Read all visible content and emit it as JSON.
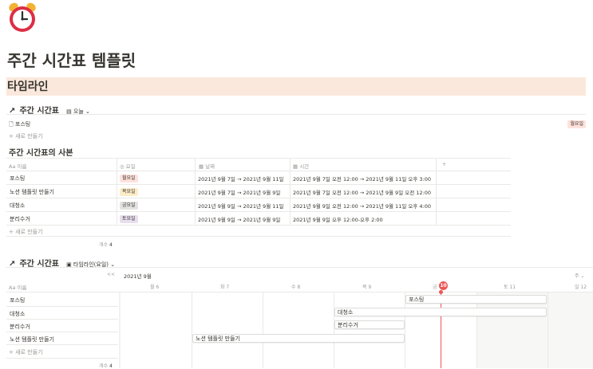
{
  "page": {
    "icon": "alarm-clock-icon",
    "title": "주간 시간표 템플릿",
    "heading": "타임라인"
  },
  "db1": {
    "title": "주간 시간표",
    "view_label": "오늘",
    "item": {
      "name": "포스팅",
      "tag": "월요일"
    },
    "new_label": "+ 새로 만들기"
  },
  "db2": {
    "title": "주간 시간표의 사본",
    "columns": [
      "이름",
      "요일",
      "날짜",
      "시간"
    ],
    "add_column": "+",
    "rows": [
      {
        "name": "포스팅",
        "day": "월요일",
        "date": "2021년 9월 7일 → 2021년 9월 11일",
        "time": "2021년 9월 7일 오전 12:00 → 2021년 9월 11일 오후 3:00"
      },
      {
        "name": "노션 템플릿 만들기",
        "day": "목요일",
        "date": "2021년 9월 7일 → 2021년 9월 9일",
        "time": "2021년 9월 7일 오전 12:00 → 2021년 9월 9일 오전 12:00"
      },
      {
        "name": "대청소",
        "day": "금요일",
        "date": "2021년 9월 9일 → 2021년 9월 11일",
        "time": "2021년 9월 9일 오전 12:00 → 2021년 9월 11일 오후 4:00"
      },
      {
        "name": "분리수거",
        "day": "토요일",
        "date": "2021년 9월 9일 → 2021년 9월 9일",
        "time": "2021년 9월 9일 오후 12:00-오후 2:00"
      }
    ],
    "new_label": "+ 새로 만들기",
    "count_label": "개수",
    "count_value": "4"
  },
  "db3": {
    "title": "주간 시간표",
    "view_label": "타임라인(요일)",
    "collapse_icon": "<<",
    "name_column": "이름",
    "month_label": "2021년 9월",
    "scale_label": "주",
    "days": [
      "월 6",
      "화 7",
      "수 8",
      "목 9",
      "금",
      "토 11",
      "일 12"
    ],
    "today_day": "10",
    "rows": [
      "포스팅",
      "대청소",
      "분리수거",
      "노션 템플릿 만들기"
    ],
    "bars": [
      "포스팅",
      "대청소",
      "분리수거",
      "노션 템플릿 만들기"
    ],
    "new_label": "+ 새로 만들기",
    "count_label": "개수",
    "count_value": "4"
  },
  "colors": {
    "heading_bg": "#fbe8dc",
    "tag_monday": "#ffe2dd",
    "tag_thursday": "#fdecc8",
    "tag_friday": "#e3e2e0",
    "tag_saturday": "#e8deee",
    "today_marker": "#eb5757"
  }
}
